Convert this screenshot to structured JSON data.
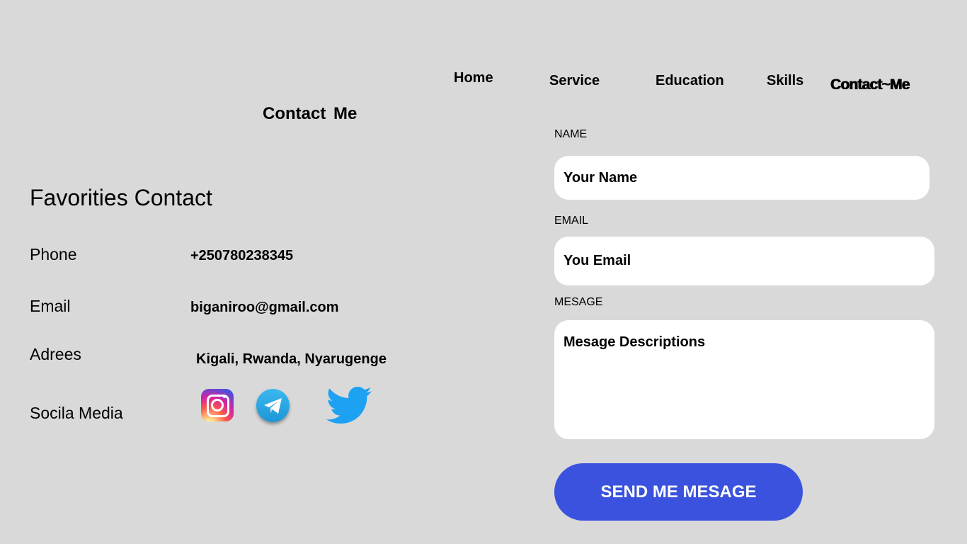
{
  "nav": {
    "home": "Home",
    "service": "Service",
    "education": "Education",
    "skills": "Skills",
    "contact": "Contact~Me"
  },
  "page_title": "Contact  Me",
  "contacts": {
    "heading": "Favorities Contact",
    "phone_label": "Phone",
    "phone_value": "+250780238345",
    "email_label": "Email",
    "email_value": "biganiroo@gmail.com",
    "address_label": "Adrees",
    "address_value": "Kigali, Rwanda, Nyarugenge",
    "social_label": "Socila Media",
    "social_icons": [
      "instagram-icon",
      "telegram-icon",
      "twitter-icon"
    ]
  },
  "form": {
    "name_label": "NAME",
    "name_placeholder": "Your Name",
    "email_label": "EMAIL",
    "email_placeholder": "You Email",
    "message_label": "MESAGE",
    "message_placeholder": "Mesage Descriptions",
    "submit_label": "SEND ME MESAGE"
  },
  "colors": {
    "background": "#d9d9d9",
    "button": "#3a52de",
    "twitter": "#1da1f2",
    "telegram": "#2aa3e0"
  }
}
